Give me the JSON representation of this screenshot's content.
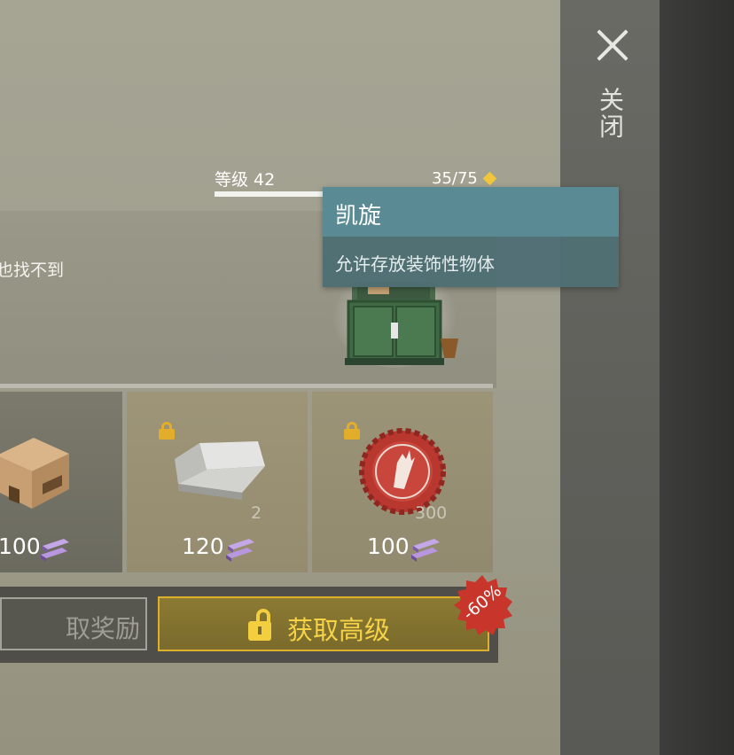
{
  "close": {
    "label": "关闭",
    "icon": "close-icon"
  },
  "level": {
    "label": "等级 42",
    "xp": "35/75",
    "xp_icon": "diamond-icon",
    "progress": 0.47
  },
  "description_partial": "也找不到",
  "tooltip": {
    "title": "凯旋",
    "text": "允许存放装饰性物体"
  },
  "rewards": [
    {
      "name": "mystery-crate",
      "price": "100",
      "currency_icon": "purple-bars-icon",
      "locked": false
    },
    {
      "name": "silver-ingot",
      "qty": "2",
      "price": "120",
      "currency_icon": "purple-bars-icon",
      "locked": true
    },
    {
      "name": "bottle-cap",
      "qty": "300",
      "price": "100",
      "currency_icon": "purple-bars-icon",
      "locked": true
    }
  ],
  "buttons": {
    "claim": "取奖励",
    "premium": "获取高级"
  },
  "discount": "-60%",
  "colors": {
    "accent_gold": "#dcb02d",
    "tooltip_title": "#5a8b94",
    "discount_red": "#c8352b"
  }
}
